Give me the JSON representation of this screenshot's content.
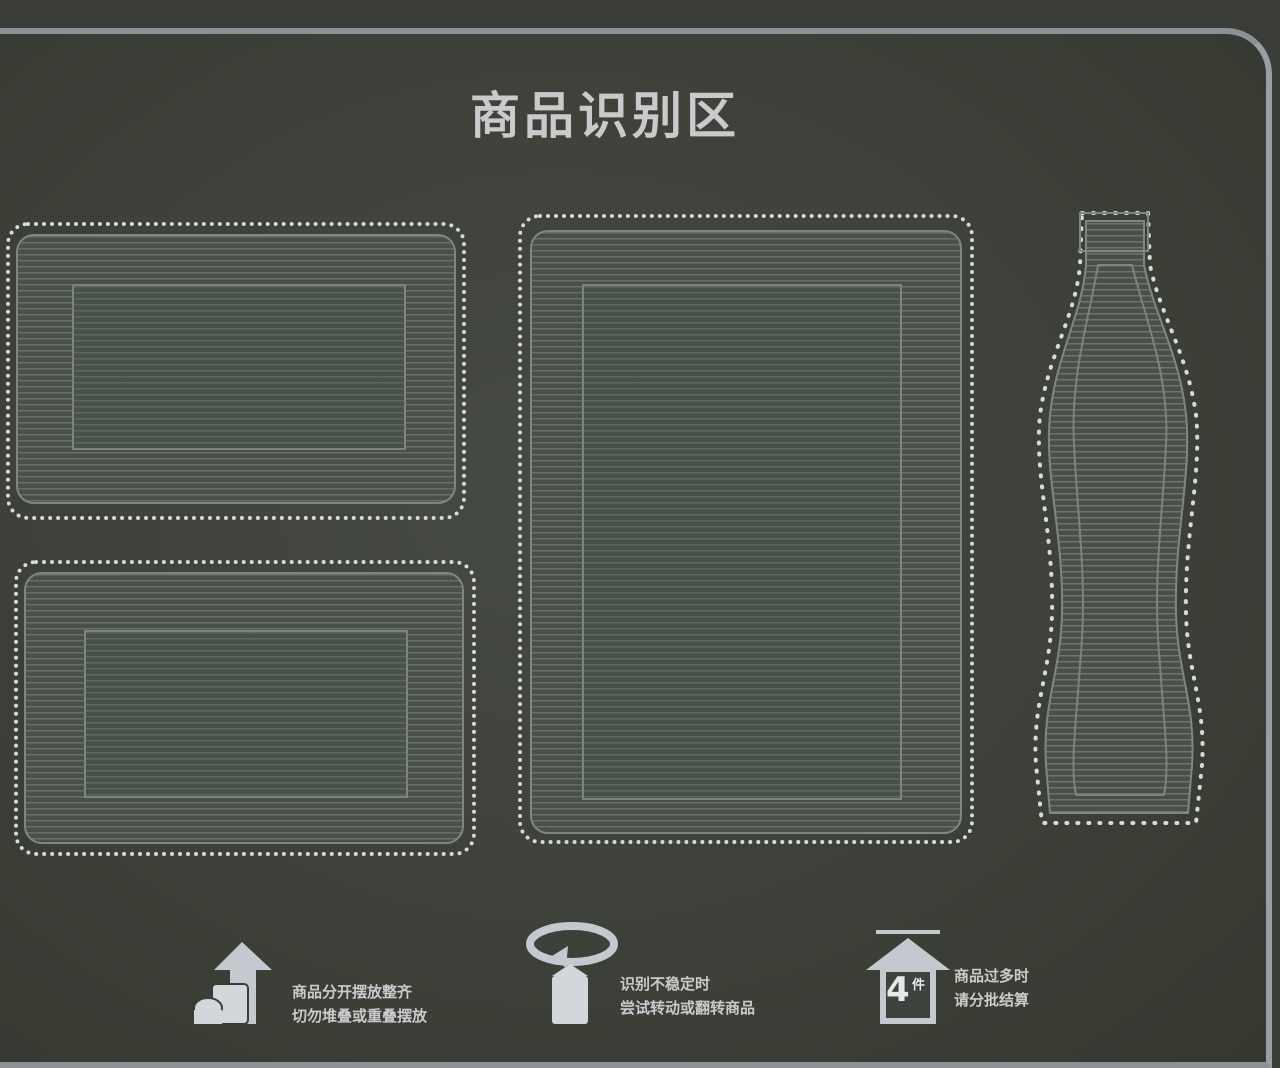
{
  "title": "商品识别区",
  "zones": [
    {
      "name": "zone-top-left"
    },
    {
      "name": "zone-bottom-left"
    },
    {
      "name": "zone-center"
    },
    {
      "name": "zone-bottle"
    }
  ],
  "hints": [
    {
      "icon": "separate-items-icon",
      "line1": "商品分开摆放整齐",
      "line2": "切勿堆叠或重叠摆放"
    },
    {
      "icon": "rotate-item-icon",
      "line1": "识别不稳定时",
      "line2": "尝试转动或翻转商品"
    },
    {
      "icon": "item-limit-icon",
      "badge": "4",
      "badge_unit": "件",
      "line1": "商品过多时",
      "line2": "请分批结算"
    }
  ]
}
